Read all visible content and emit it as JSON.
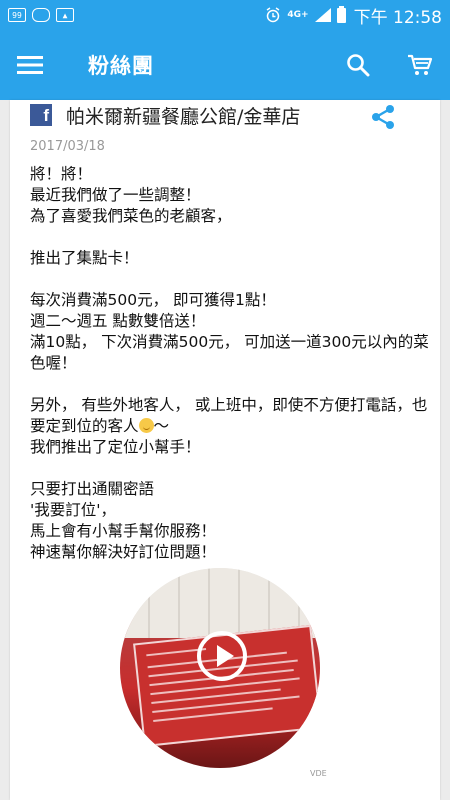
{
  "status_bar": {
    "left_icons": [
      "notification-app-icon",
      "cloud-icon",
      "image-icon"
    ],
    "network": "4G+",
    "time": "下午 12:58"
  },
  "app_bar": {
    "title": "粉絲團"
  },
  "post": {
    "shop_name": "帕米爾新疆餐廳公館/金華店",
    "date": "2017/03/18",
    "body_part1": "將！將！\n最近我們做了一些調整！\n為了喜愛我們菜色的老顧客，\n\n推出了集點卡！\n\n每次消費滿500元， 即可獲得1點！\n週二～週五 點數雙倍送！\n滿10點， 下次消費滿500元， 可加送一道300元以內的菜色喔！\n\n另外， 有些外地客人， 或上班中，即使不方便打電話，也要定到位的客人",
    "body_part2": "～\n我們推出了定位小幫手！\n\n只要打出通關密語\n'我要訂位'，\n馬上會有小幫手幫你服務！\n神速幫你解決好訂位問題！",
    "video_watermark": "VDE"
  },
  "colors": {
    "accent": "#2aa3ea",
    "facebook": "#3b5998",
    "date_text": "#999999"
  }
}
